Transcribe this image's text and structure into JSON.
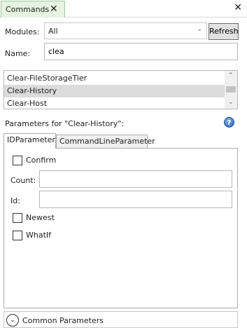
{
  "window": {
    "tab_title": "Commands",
    "tab_close": "✕",
    "close": "✕"
  },
  "modules": {
    "label": "Modules:",
    "selected": "All",
    "arrow": "⌄",
    "refresh_label": "Refresh"
  },
  "name": {
    "label": "Name:",
    "value": "clea"
  },
  "commands": {
    "items": [
      "Clear-FileStorageTier",
      "Clear-History",
      "Clear-Host"
    ],
    "selected_index": 1,
    "scroll_up": "⌃",
    "scroll_down": "⌄"
  },
  "parameters": {
    "heading": "Parameters for \"Clear-History\":",
    "help": "?",
    "tabs": [
      "IDParameter",
      "CommandLineParameter"
    ],
    "active_tab": 0,
    "confirm_label": "Confirm",
    "count_label": "Count:",
    "count_value": "",
    "id_label": "Id:",
    "id_value": "",
    "newest_label": "Newest",
    "whatif_label": "WhatIf"
  },
  "common": {
    "label": "Common Parameters",
    "expander": "⌄"
  }
}
